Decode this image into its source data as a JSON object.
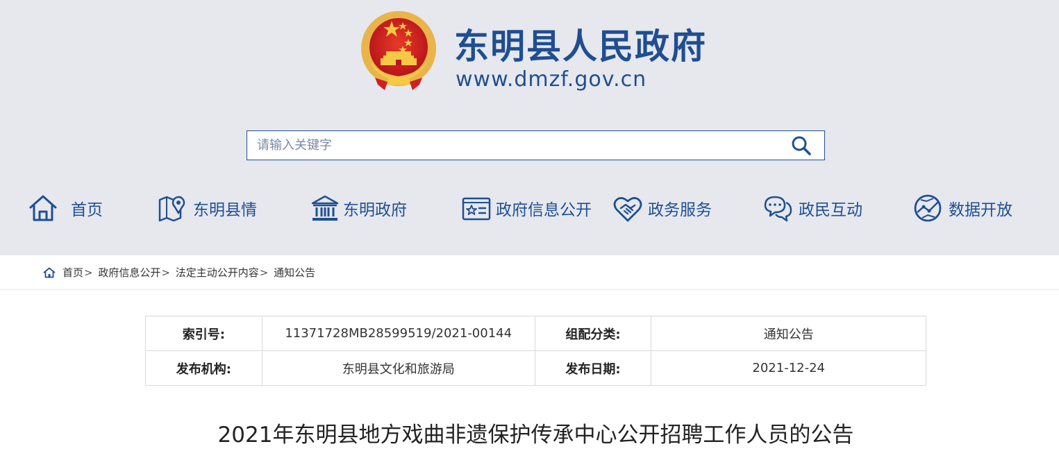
{
  "header": {
    "site_title": "东明县人民政府",
    "site_url": "www.dmzf.gov.cn",
    "brand_color": "#1f4e91",
    "background_color": "#e6e8ee"
  },
  "search": {
    "placeholder": "请输入关键字",
    "value": "",
    "button_icon": "search-icon"
  },
  "nav": {
    "items": [
      {
        "label": "首页",
        "icon": "home-icon"
      },
      {
        "label": "东明县情",
        "icon": "map-pin-icon"
      },
      {
        "label": "东明政府",
        "icon": "government-building-icon"
      },
      {
        "label": "政府信息公开",
        "icon": "info-card-icon"
      },
      {
        "label": "政务服务",
        "icon": "handshake-heart-icon"
      },
      {
        "label": "政民互动",
        "icon": "chat-bubbles-icon"
      },
      {
        "label": "数据开放",
        "icon": "data-globe-icon"
      }
    ]
  },
  "breadcrumb": {
    "home_icon": "home-icon",
    "items": [
      "首页",
      "政府信息公开",
      "法定主动公开内容",
      "通知公告"
    ],
    "separator": ">"
  },
  "meta": {
    "rows": [
      {
        "k1": "索引号:",
        "v1": "11371728MB28599519/2021-00144",
        "k2": "组配分类:",
        "v2": "通知公告"
      },
      {
        "k1": "发布机构:",
        "v1": "东明县文化和旅游局",
        "k2": "发布日期:",
        "v2": "2021-12-24"
      }
    ]
  },
  "article": {
    "title": "2021年东明县地方戏曲非遗保护传承中心公开招聘工作人员的公告"
  }
}
